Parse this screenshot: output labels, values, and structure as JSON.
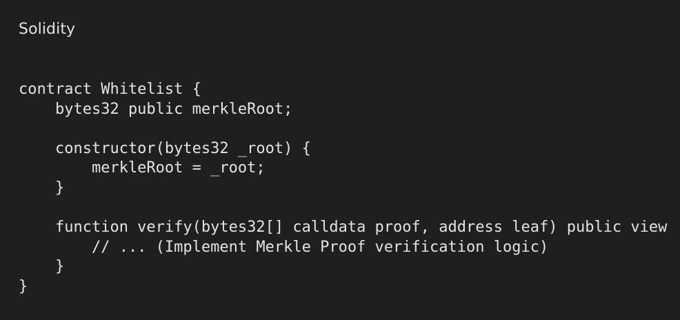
{
  "code_block": {
    "language": "Solidity",
    "lines": [
      "contract Whitelist {",
      "    bytes32 public merkleRoot;",
      "",
      "    constructor(bytes32 _root) {",
      "        merkleRoot = _root;",
      "    }",
      "",
      "    function verify(bytes32[] calldata proof, address leaf) public view",
      "        // ... (Implement Merkle Proof verification logic)",
      "    }",
      "}"
    ]
  }
}
